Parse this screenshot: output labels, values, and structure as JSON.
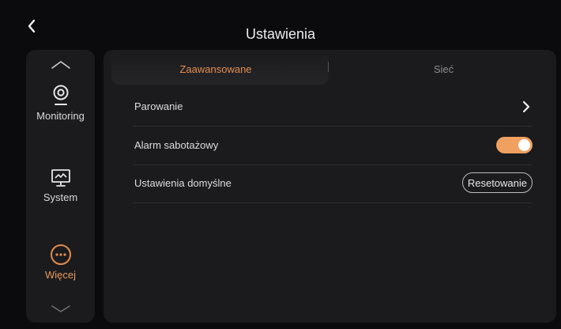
{
  "header": {
    "title": "Ustawienia",
    "back_icon": "chevron-left-icon"
  },
  "sidebar": {
    "items": [
      {
        "label": "Monitoring",
        "icon": "camera-icon",
        "active": false
      },
      {
        "label": "System",
        "icon": "monitor-icon",
        "active": false
      },
      {
        "label": "Więcej",
        "icon": "more-icon",
        "active": true
      }
    ]
  },
  "tabs": [
    {
      "label": "Zaawansowane",
      "active": true
    },
    {
      "label": "Sieć",
      "active": false
    }
  ],
  "settings": {
    "pairing": {
      "label": "Parowanie"
    },
    "tamper": {
      "label": "Alarm sabotażowy",
      "enabled": true
    },
    "defaults": {
      "label": "Ustawienia domyślne",
      "button": "Resetowanie"
    }
  },
  "colors": {
    "accent": "#f0a05f",
    "active_text": "#e38d4e",
    "background": "#0b0b0d",
    "panel": "#1b1b1e"
  }
}
